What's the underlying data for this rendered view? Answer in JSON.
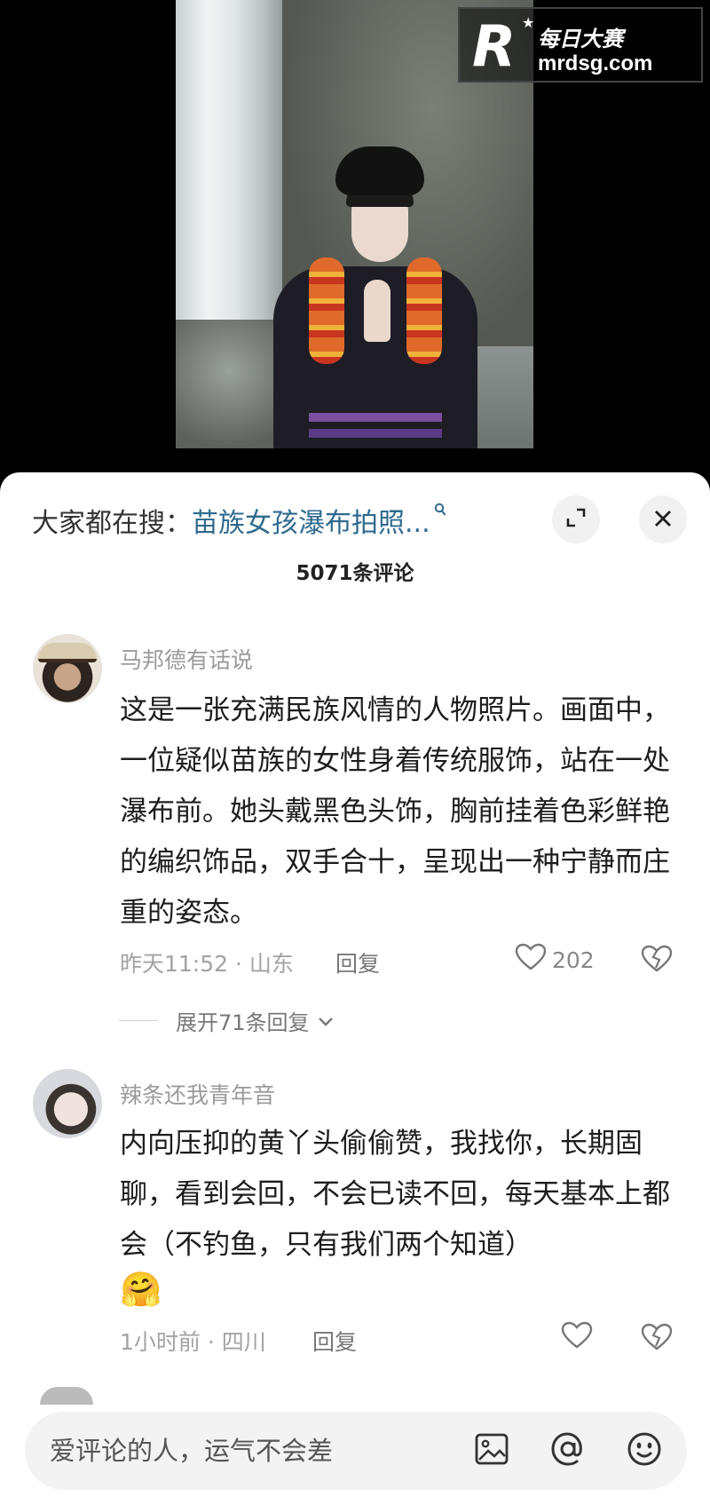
{
  "watermark": {
    "logo": "R",
    "brand": "每日大赛",
    "url": "mrdsg.com"
  },
  "search": {
    "prefix": "大家都在搜：",
    "term": "苗族女孩瀑布拍照..."
  },
  "comments_count": "5071条评论",
  "comments": [
    {
      "user": "马邦德有话说",
      "text": "这是一张充满民族风情的人物照片。画面中，一位疑似苗族的女性身着传统服饰，站在一处瀑布前。她头戴黑色头饰，胸前挂着色彩鲜艳的编织饰品，双手合十，呈现出一种宁静而庄重的姿态。",
      "time_location": "昨天11:52 · 山东",
      "reply_label": "回复",
      "likes": "202",
      "expand": "展开71条回复"
    },
    {
      "user": "辣条还我青年音",
      "text": "内向压抑的黄丫头偷偷赞，我找你，长期固聊，看到会回，不会已读不回，每天基本上都会（不钓鱼，只有我们两个知道）",
      "time_location": "1小时前 · 四川",
      "reply_label": "回复",
      "likes": ""
    }
  ],
  "input": {
    "placeholder": "爱评论的人，运气不会差"
  },
  "icons": [
    "expand-icon",
    "close-icon",
    "heart-icon",
    "dislike-icon",
    "image-icon",
    "at-icon",
    "emoji-icon",
    "search-icon"
  ]
}
